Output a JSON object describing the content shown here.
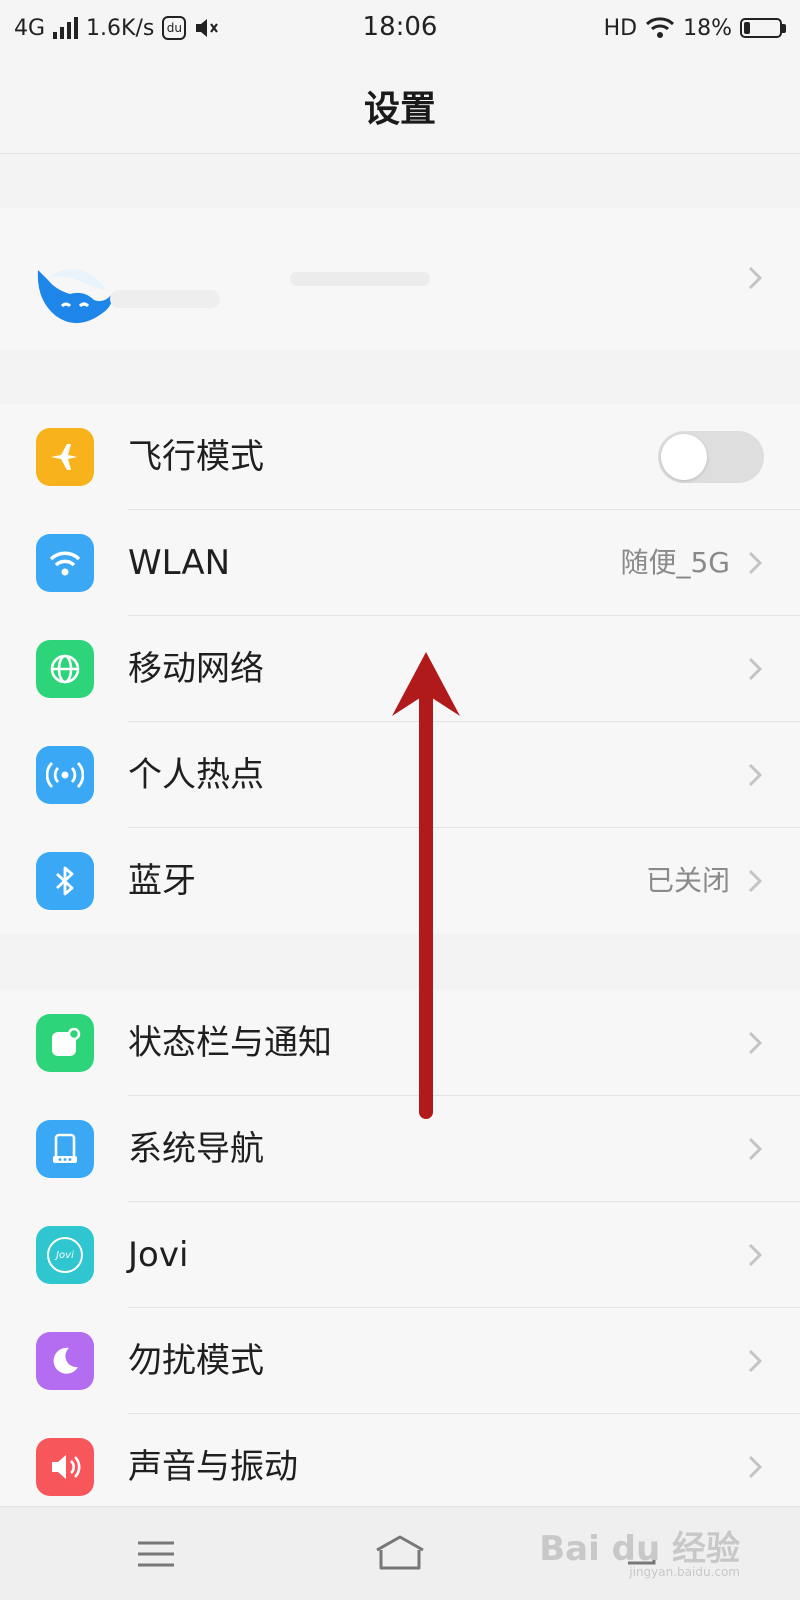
{
  "status_bar": {
    "network": "4G",
    "speed": "1.6K/s",
    "app_badge": "du",
    "time": "18:06",
    "hd": "HD",
    "battery_percent": "18%",
    "battery_level": 0.18
  },
  "header": {
    "title": "设置"
  },
  "sections": {
    "connectivity": [
      {
        "label": "飞行模式",
        "icon": "airplane-icon",
        "color": "#f8b21c",
        "toggle": false
      },
      {
        "label": "WLAN",
        "icon": "wifi-icon",
        "color": "#3aa8f5",
        "value": "随便_5G"
      },
      {
        "label": "移动网络",
        "icon": "globe-icon",
        "color": "#2ed47a"
      },
      {
        "label": "个人热点",
        "icon": "hotspot-icon",
        "color": "#3aa8f5"
      },
      {
        "label": "蓝牙",
        "icon": "bluetooth-icon",
        "color": "#3aa8f5",
        "value": "已关闭"
      }
    ],
    "system": [
      {
        "label": "状态栏与通知",
        "icon": "notification-icon",
        "color": "#2ed47a"
      },
      {
        "label": "系统导航",
        "icon": "navigation-icon",
        "color": "#3aa8f5"
      },
      {
        "label": "Jovi",
        "icon": "jovi-icon",
        "color": "#2fc6d0",
        "icon_text": "Jovi"
      },
      {
        "label": "勿扰模式",
        "icon": "moon-icon",
        "color": "#b46cf0"
      },
      {
        "label": "声音与振动",
        "icon": "speaker-icon",
        "color": "#f7575b"
      }
    ]
  },
  "overlay": {
    "arrow_color": "#b01a1a"
  },
  "watermark": {
    "text": "Bai du 经验",
    "sub": "jingyan.baidu.com"
  }
}
